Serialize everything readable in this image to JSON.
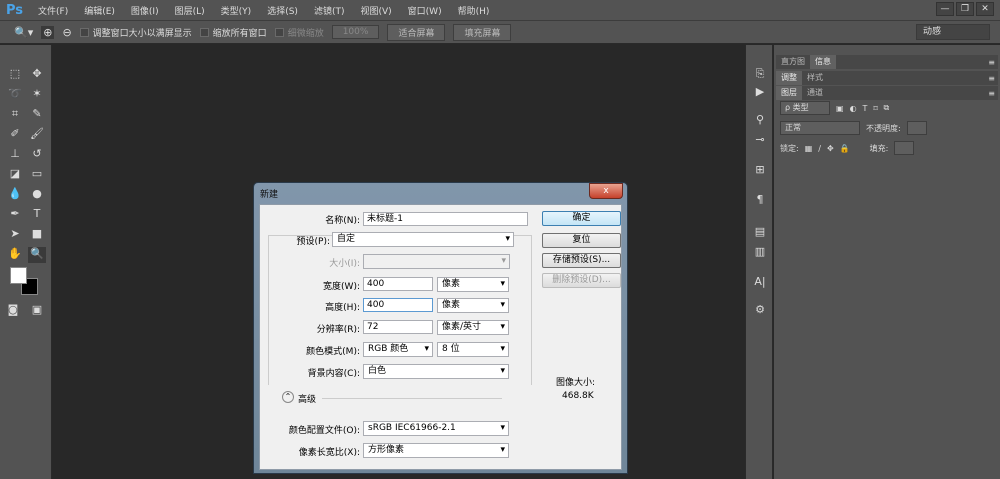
{
  "app": {
    "logo": "Ps",
    "menus": [
      "文件(F)",
      "编辑(E)",
      "图像(I)",
      "图层(L)",
      "类型(Y)",
      "选择(S)",
      "滤镜(T)",
      "视图(V)",
      "窗口(W)",
      "帮助(H)"
    ],
    "window_controls": [
      "—",
      "❐",
      "✕"
    ]
  },
  "options": {
    "zoom_icon": "zoom-icon",
    "chk_resize": "调整窗口大小以满屏显示",
    "chk_all": "缩放所有窗口",
    "chk_scrub": "细微缩放",
    "btn_100": "100%",
    "btn_fit": "适合屏幕",
    "btn_fill": "填充屏幕",
    "workspace": "动感"
  },
  "panels": {
    "tabs1": [
      "直方图",
      "信息"
    ],
    "tabs2": [
      "调整",
      "样式"
    ],
    "tabs3": [
      "图层",
      "通道"
    ],
    "filter_kind": "ρ 类型",
    "blend_mode": "正常",
    "opacity_label": "不透明度:",
    "lock_label": "锁定:",
    "fill_label": "填充:"
  },
  "dialog": {
    "title": "新建",
    "close": "x",
    "name_label": "名称(N):",
    "name_value": "未标题-1",
    "preset_label": "预设(P):",
    "preset_value": "自定",
    "size_label": "大小(I):",
    "size_value": "",
    "width_label": "宽度(W):",
    "width_value": "400",
    "width_unit": "像素",
    "height_label": "高度(H):",
    "height_value": "400",
    "height_unit": "像素",
    "res_label": "分辨率(R):",
    "res_value": "72",
    "res_unit": "像素/英寸",
    "mode_label": "颜色模式(M):",
    "mode_value": "RGB 颜色",
    "bit_value": "8 位",
    "bg_label": "背景内容(C):",
    "bg_value": "白色",
    "advanced": "高级",
    "profile_label": "颜色配置文件(O):",
    "profile_value": "sRGB IEC61966-2.1",
    "aspect_label": "像素长宽比(X):",
    "aspect_value": "方形像素",
    "ok": "确定",
    "reset": "复位",
    "save_preset": "存储预设(S)...",
    "delete_preset": "删除预设(D)...",
    "image_size_label": "图像大小:",
    "image_size_value": "468.8K"
  }
}
